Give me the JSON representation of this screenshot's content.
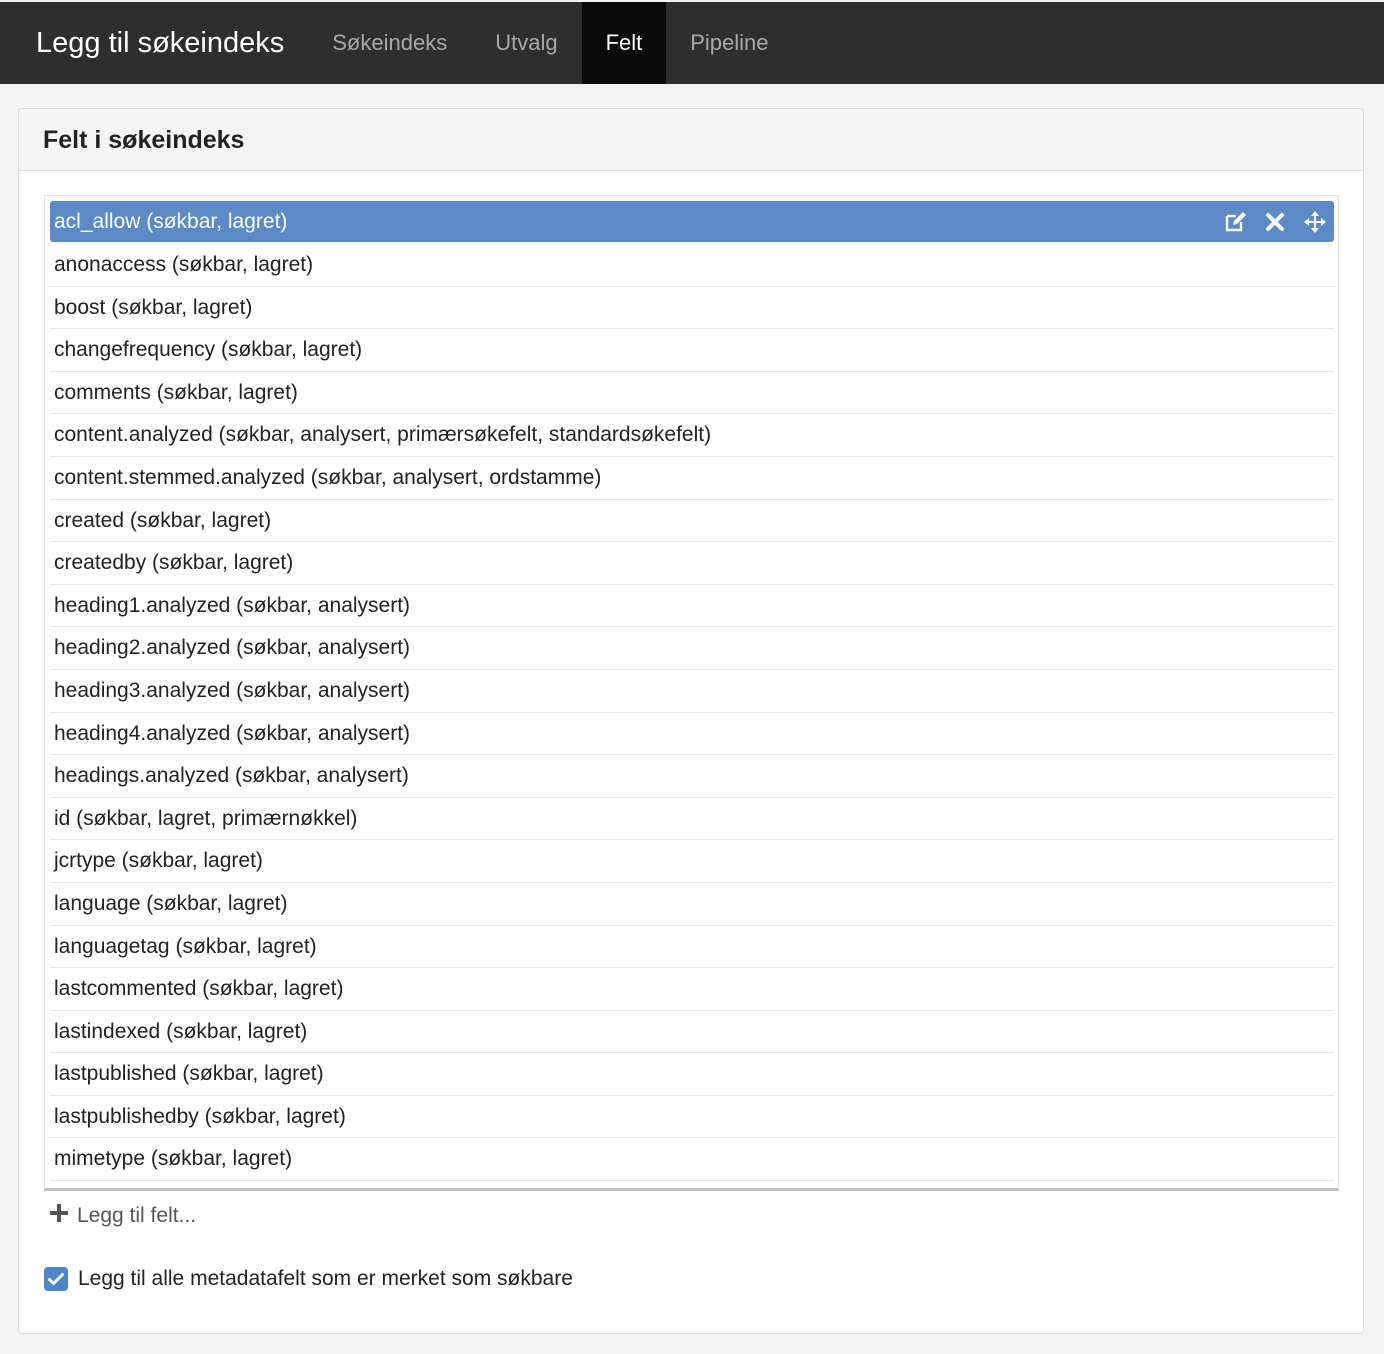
{
  "header": {
    "title": "Legg til søkeindeks",
    "tabs": [
      {
        "label": "Søkeindeks",
        "active": false
      },
      {
        "label": "Utvalg",
        "active": false
      },
      {
        "label": "Felt",
        "active": true
      },
      {
        "label": "Pipeline",
        "active": false
      }
    ]
  },
  "panel": {
    "title": "Felt i søkeindeks"
  },
  "fields": [
    "acl_allow (søkbar, lagret)",
    "anonaccess (søkbar, lagret)",
    "boost (søkbar, lagret)",
    "changefrequency (søkbar, lagret)",
    "comments (søkbar, lagret)",
    "content.analyzed (søkbar, analysert, primærsøkefelt, standardsøkefelt)",
    "content.stemmed.analyzed (søkbar, analysert, ordstamme)",
    "created (søkbar, lagret)",
    "createdby (søkbar, lagret)",
    "heading1.analyzed (søkbar, analysert)",
    "heading2.analyzed (søkbar, analysert)",
    "heading3.analyzed (søkbar, analysert)",
    "heading4.analyzed (søkbar, analysert)",
    "headings.analyzed (søkbar, analysert)",
    "id (søkbar, lagret, primærnøkkel)",
    "jcrtype (søkbar, lagret)",
    "language (søkbar, lagret)",
    "languagetag (søkbar, lagret)",
    "lastcommented (søkbar, lagret)",
    "lastindexed (søkbar, lagret)",
    "lastpublished (søkbar, lagret)",
    "lastpublishedby (søkbar, lagret)",
    "mimetype (søkbar, lagret)"
  ],
  "selected_index": 0,
  "row_icons": [
    "edit-icon",
    "close-icon",
    "move-icon"
  ],
  "add_field_label": "Legg til felt...",
  "metadata_checkbox": {
    "label": "Legg til alle metadatafelt som er merket som søkbare",
    "checked": true
  },
  "colors": {
    "topbar": "#2e2e2e",
    "active_tab": "#0a0a0a",
    "selected_row": "#5b8ac6",
    "checkbox": "#4a86c8"
  }
}
